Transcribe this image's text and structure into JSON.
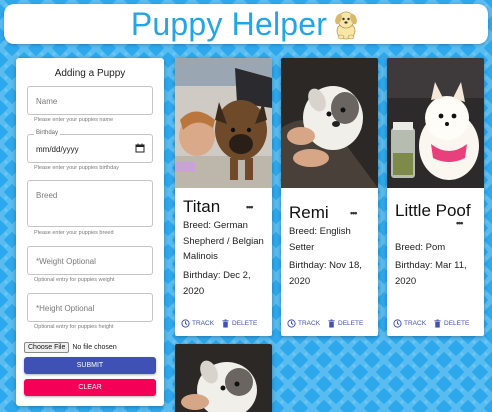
{
  "header": {
    "title": "Puppy Helper",
    "logo_icon": "puppy-logo-icon"
  },
  "form": {
    "title": "Adding a Puppy",
    "name": {
      "placeholder": "Name",
      "helper": "Please enter your puppies name"
    },
    "birthday": {
      "label": "Birthday",
      "value": "mm/dd/yyyy",
      "helper": "Please enter your puppies birthday"
    },
    "breed": {
      "placeholder": "Breed",
      "helper": "Please enter your puppies breed"
    },
    "weight": {
      "placeholder": "*Weight Optional",
      "helper": "Optional entry for puppies weight"
    },
    "height": {
      "placeholder": "*Height Optional",
      "helper": "Optional entry for puppies height"
    },
    "file": {
      "button": "Choose File",
      "status": "No file chosen"
    },
    "submit_label": "SUBMIT",
    "clear_label": "CLEAR",
    "colors": {
      "submit": "#3f51b5",
      "clear": "#f50057"
    }
  },
  "pets": [
    {
      "name": "Titan",
      "breed": "Breed: German Shepherd / Belgian Malinois",
      "birthday": "Birthday: Dec 2, 2020",
      "track_label": "TRACK",
      "delete_label": "DELETE",
      "more_icon": "more-dots-icon"
    },
    {
      "name": "Remi",
      "breed": "Breed: English Setter",
      "birthday": "Birthday: Nov 18, 2020",
      "track_label": "TRACK",
      "delete_label": "DELETE",
      "more_icon": "more-dots-icon"
    },
    {
      "name": "Little Poof",
      "breed": "Breed: Pom",
      "birthday": "Birthday: Mar 11, 2020",
      "track_label": "TRACK",
      "delete_label": "DELETE",
      "more_icon": "more-dots-icon"
    }
  ],
  "theme": {
    "accent": "#23a5e6",
    "action": "#3f51b5",
    "background": "#2ea8ec"
  }
}
